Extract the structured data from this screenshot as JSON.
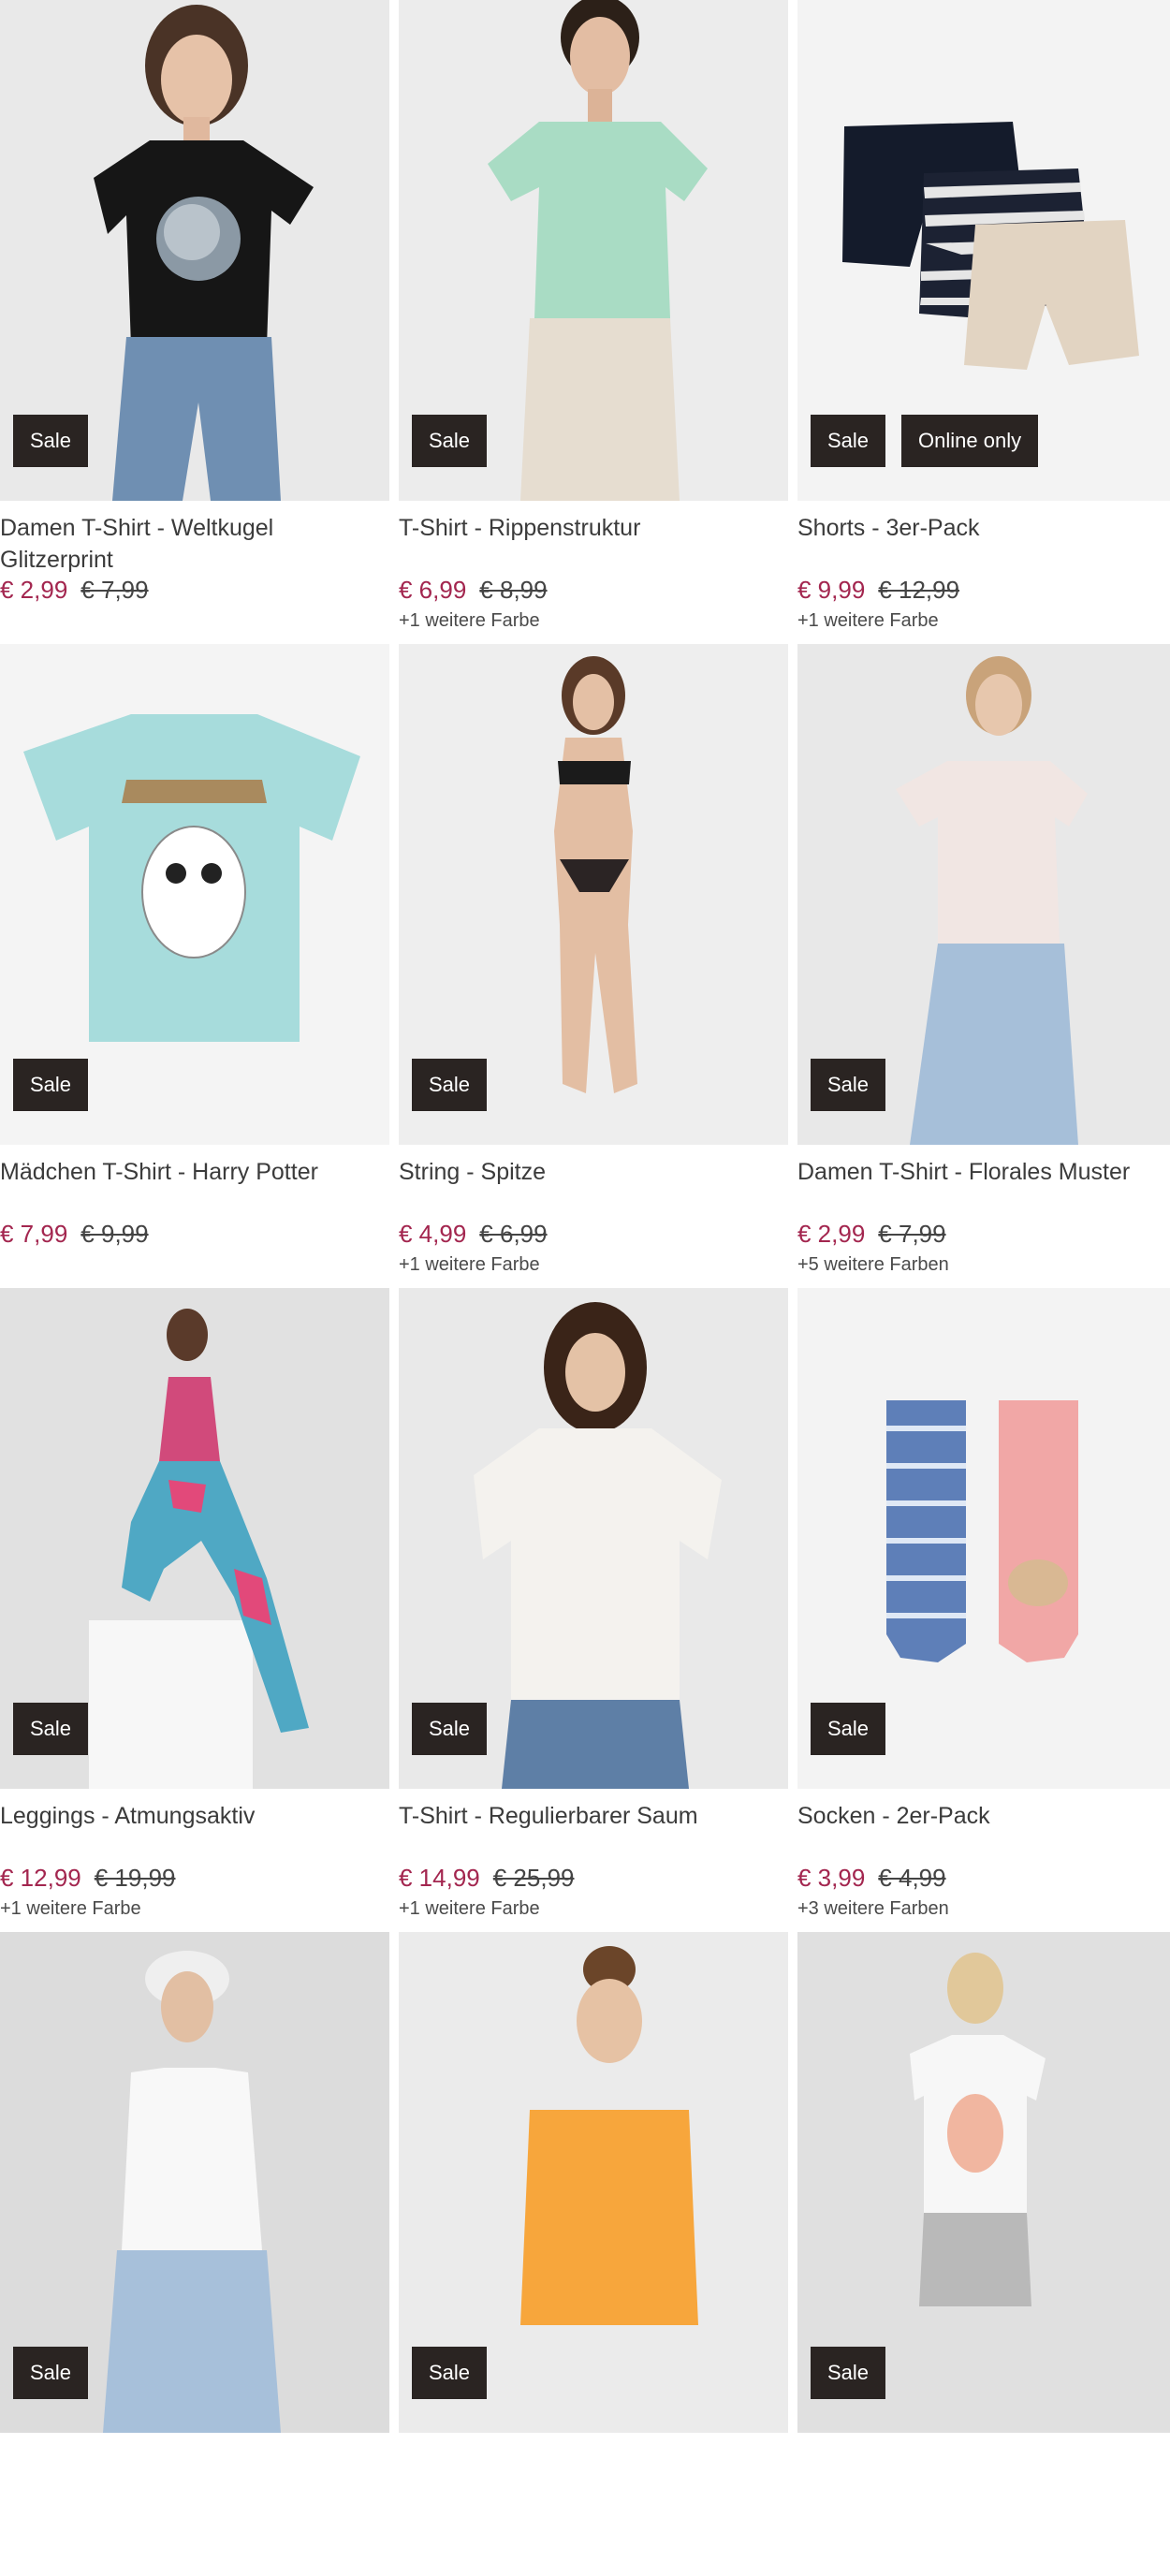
{
  "products": [
    {
      "title": "Damen T-Shirt - Weltkugel Glitzerprint",
      "badges": [
        "Sale"
      ],
      "price": "€ 2,99",
      "old_price": "€ 7,99",
      "more": ""
    },
    {
      "title": "T-Shirt - Rippenstruktur",
      "badges": [
        "Sale"
      ],
      "price": "€ 6,99",
      "old_price": "€ 8,99",
      "more": "+1 weitere Farbe"
    },
    {
      "title": "Shorts - 3er-Pack",
      "badges": [
        "Sale",
        "Online only"
      ],
      "price": "€ 9,99",
      "old_price": "€ 12,99",
      "more": "+1 weitere Farbe"
    },
    {
      "title": "Mädchen T-Shirt - Harry Potter",
      "badges": [
        "Sale"
      ],
      "price": "€ 7,99",
      "old_price": "€ 9,99",
      "more": ""
    },
    {
      "title": "String - Spitze",
      "badges": [
        "Sale"
      ],
      "price": "€ 4,99",
      "old_price": "€ 6,99",
      "more": "+1 weitere Farbe"
    },
    {
      "title": "Damen T-Shirt - Florales Muster",
      "badges": [
        "Sale"
      ],
      "price": "€ 2,99",
      "old_price": "€ 7,99",
      "more": "+5 weitere Farben"
    },
    {
      "title": "Leggings - Atmungsaktiv",
      "badges": [
        "Sale"
      ],
      "price": "€ 12,99",
      "old_price": "€ 19,99",
      "more": "+1 weitere Farbe"
    },
    {
      "title": "T-Shirt - Regulierbarer Saum",
      "badges": [
        "Sale"
      ],
      "price": "€ 14,99",
      "old_price": "€ 25,99",
      "more": "+1 weitere Farbe"
    },
    {
      "title": "Socken - 2er-Pack",
      "badges": [
        "Sale"
      ],
      "price": "€ 3,99",
      "old_price": "€ 4,99",
      "more": "+3 weitere Farben"
    },
    {
      "title": "",
      "badges": [
        "Sale"
      ],
      "price": "",
      "old_price": "",
      "more": ""
    },
    {
      "title": "",
      "badges": [
        "Sale"
      ],
      "price": "",
      "old_price": "",
      "more": ""
    },
    {
      "title": "",
      "badges": [
        "Sale"
      ],
      "price": "",
      "old_price": "",
      "more": ""
    }
  ],
  "colors": {
    "price_sale": "#a3264f",
    "badge_bg": "#2a2422",
    "image_bg": "#ededed"
  }
}
